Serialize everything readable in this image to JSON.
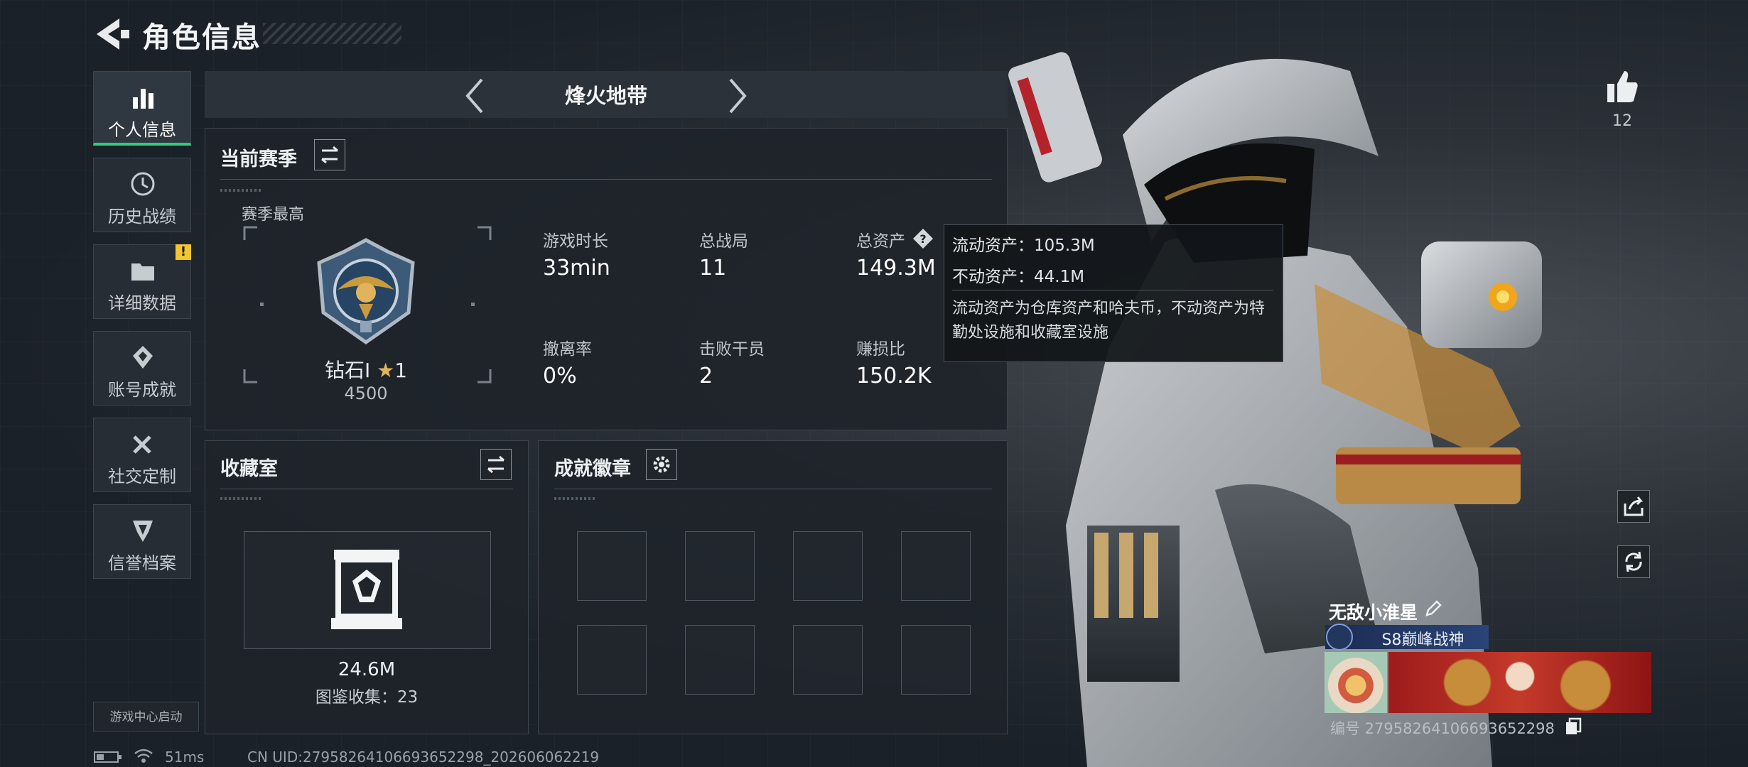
{
  "header": {
    "title": "角色信息"
  },
  "sidebar": {
    "items": [
      {
        "label": "个人信息",
        "icon": "bar-chart-icon",
        "active": true
      },
      {
        "label": "历史战绩",
        "icon": "history-icon"
      },
      {
        "label": "详细数据",
        "icon": "folder-icon",
        "badge": "!"
      },
      {
        "label": "账号成就",
        "icon": "achievement-icon"
      },
      {
        "label": "社交定制",
        "icon": "tools-icon"
      },
      {
        "label": "信誉档案",
        "icon": "credit-shield-icon"
      }
    ],
    "game_center": "游戏中心启动"
  },
  "mode": {
    "label": "烽火地带"
  },
  "season": {
    "title": "当前赛季",
    "best_label": "赛季最高",
    "rank_name": "钻石Ⅰ",
    "rank_stars": "1",
    "rank_score": "4500",
    "stats": [
      {
        "label": "游戏时长",
        "value": "33min"
      },
      {
        "label": "总战局",
        "value": "11"
      },
      {
        "label": "总资产",
        "value": "149.3M"
      },
      {
        "label": "撤离率",
        "value": "0%"
      },
      {
        "label": "击败干员",
        "value": "2"
      },
      {
        "label": "赚损比",
        "value": "150.2K"
      }
    ]
  },
  "tooltip": {
    "line1": "流动资产：105.3M",
    "line2": "不动资产：44.1M",
    "desc": "流动资产为仓库资产和哈夫币，不动资产为特勤处设施和收藏室设施"
  },
  "collection": {
    "title": "收藏室",
    "value": "24.6M",
    "collect": "图鉴收集：23"
  },
  "badges": {
    "title": "成就徽章",
    "slots": 8
  },
  "profile": {
    "likes": "12",
    "name": "无敌小淮星",
    "title_tag": "S8巅峰战神",
    "id_text": "编号 2795826410669365​2298"
  },
  "status": {
    "ping": "51ms",
    "uid": "CN UID:2795826410669365​2298_202606062219"
  },
  "colors": {
    "accent": "#29d17a",
    "warning": "#f2c531",
    "background": "#1b2128"
  }
}
